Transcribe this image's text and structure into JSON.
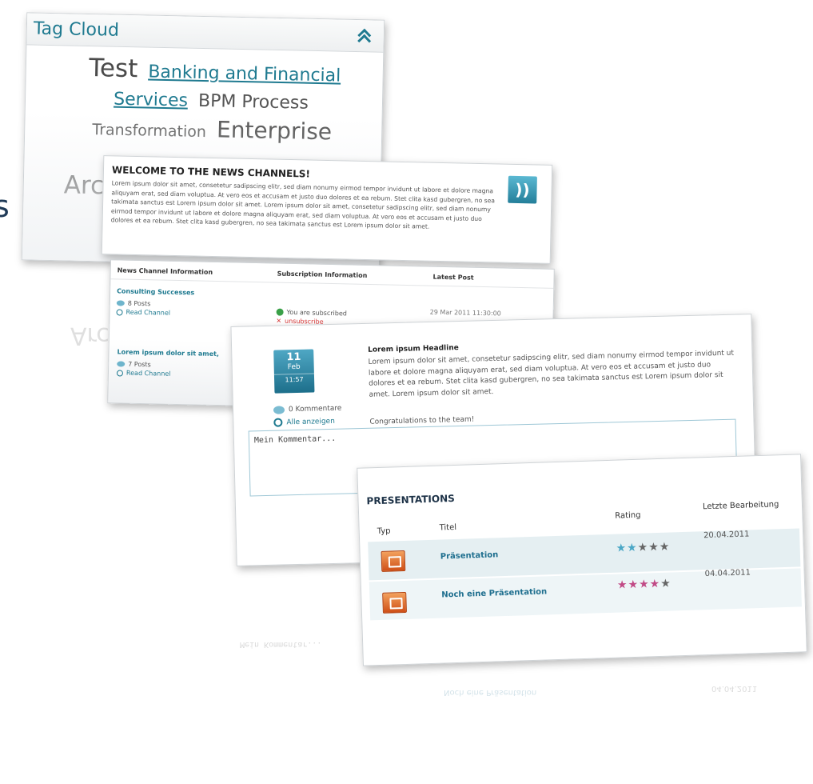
{
  "tag_cloud": {
    "title": "Tag Cloud",
    "tags": [
      {
        "label": "Test",
        "size": "xl"
      },
      {
        "label": "Banking and Financial Services",
        "size": "link"
      },
      {
        "label": "BPM Process",
        "size": "m"
      },
      {
        "label": "Transformation",
        "size": "s"
      },
      {
        "label": "Enterprise",
        "size": "l"
      }
    ],
    "partial_tag": "Arc"
  },
  "left_edge_text": "s",
  "news": {
    "heading": "WELCOME TO THE NEWS CHANNELS!",
    "body": "Lorem ipsum dolor sit amet, consetetur sadipscing elitr, sed diam nonumy eirmod tempor invidunt ut labore et dolore magna aliquyam erat, sed diam voluptua. At vero eos et accusam et justo duo dolores et ea rebum. Stet clita kasd gubergren, no sea takimata sanctus est Lorem ipsum dolor sit amet. Lorem ipsum dolor sit amet, consetetur sadipscing elitr, sed diam nonumy eirmod tempor invidunt ut labore et dolore magna aliquyam erat, sed diam voluptua. At vero eos et accusam et justo duo dolores et ea rebum. Stet clita kasd gubergren, no sea takimata sanctus est Lorem ipsum dolor sit amet.",
    "rss_glyph": "))",
    "columns": [
      "News Channel Information",
      "Subscription Information",
      "Latest Post"
    ],
    "channels": [
      {
        "name": "Consulting Successes",
        "posts": "8 Posts",
        "read": "Read Channel",
        "subscribed": "You are subscribed",
        "unsubscribe": "unsubscribe",
        "latest": "29 Mar 2011 11:30:00"
      },
      {
        "name": "Lorem ipsum dolor sit amet,",
        "posts": "7 Posts",
        "read": "Read Channel"
      }
    ]
  },
  "post": {
    "date": {
      "day": "11",
      "month": "Feb",
      "time": "11:57"
    },
    "comments": "0 Kommentare",
    "show_all": "Alle anzeigen",
    "headline": "Lorem ipsum Headline",
    "body": "Lorem ipsum dolor sit amet, consetetur sadipscing elitr, sed diam nonumy eirmod tempor invidunt ut labore et dolore magna aliquyam erat, sed diam voluptua. At vero eos et accusam et justo duo dolores et ea rebum. Stet clita kasd gubergren, no sea takimata sanctus est Lorem ipsum dolor sit amet. Lorem ipsum dolor sit amet.",
    "congrats": "Congratulations to the team!",
    "comment_placeholder": "Mein Kommentar..."
  },
  "presentations": {
    "heading": "PRESENTATIONS",
    "columns": {
      "type": "Typ",
      "title": "Titel",
      "rating": "Rating",
      "last_edit": "Letzte Bearbeitung"
    },
    "rows": [
      {
        "title": "Präsentation",
        "rating": 2,
        "rating_color": "#4ba7c6",
        "date": "20.04.2011"
      },
      {
        "title": "Noch eine Präsentation",
        "rating": 4,
        "rating_color": "#c14a86",
        "date": "04.04.2011"
      }
    ],
    "rating_max": 5
  },
  "colors": {
    "accent": "#1f7a90",
    "brand_dark": "#1d3247",
    "ppt_orange": "#cf4f17"
  }
}
